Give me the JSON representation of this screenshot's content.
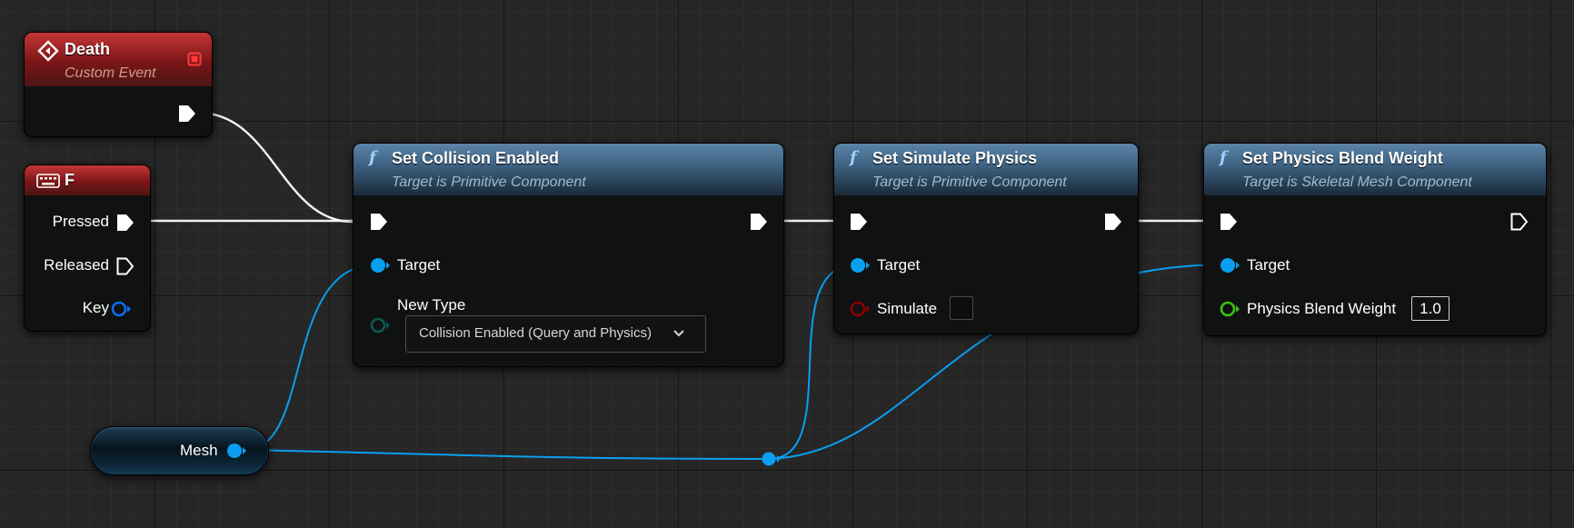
{
  "death_event": {
    "title": "Death",
    "subtitle": "Custom Event"
  },
  "key_f": {
    "title": "F",
    "pins": {
      "pressed": "Pressed",
      "released": "Released",
      "key": "Key"
    }
  },
  "set_collision": {
    "title": "Set Collision Enabled",
    "subtitle": "Target is Primitive Component",
    "target_label": "Target",
    "new_type_label": "New Type",
    "new_type_value": "Collision Enabled (Query and Physics)"
  },
  "set_simulate": {
    "title": "Set Simulate Physics",
    "subtitle": "Target is Primitive Component",
    "target_label": "Target",
    "simulate_label": "Simulate"
  },
  "set_blend": {
    "title": "Set Physics Blend Weight",
    "subtitle": "Target is Skeletal Mesh Component",
    "target_label": "Target",
    "weight_label": "Physics Blend Weight",
    "weight_value": "1.0"
  },
  "mesh_var": {
    "label": "Mesh"
  },
  "colors": {
    "exec": "#ffffff",
    "object_pin": "#0a9eef",
    "bool_pin": "#8b0000",
    "float_pin": "#3ac30e",
    "enum_pin": "#0b5a50",
    "event_header": "#8d1c1d",
    "function_header": "#4a7090"
  }
}
